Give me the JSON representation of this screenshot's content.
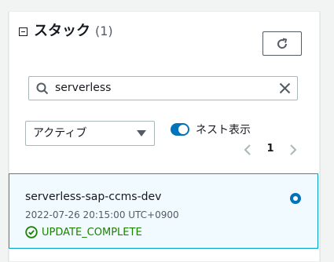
{
  "header": {
    "title": "スタック",
    "count": "(1)"
  },
  "search": {
    "value": "serverless"
  },
  "filter": {
    "selected": "アクティブ"
  },
  "nested_toggle": {
    "label": "ネスト表示",
    "on": true
  },
  "pagination": {
    "current_page": "1"
  },
  "stacks": [
    {
      "name": "serverless-sap-ccms-dev",
      "created": "2022-07-26 20:15:00 UTC+0900",
      "status": "UPDATE_COMPLETE",
      "selected": true
    }
  ],
  "colors": {
    "accent": "#0073bb",
    "selected_border": "#00a1c9",
    "selected_bg": "#f1faff",
    "success": "#1d8102"
  },
  "icons": {
    "collapse": "collapse-icon",
    "refresh": "refresh-icon",
    "search": "search-icon",
    "clear": "close-icon",
    "caret": "caret-down-icon",
    "prev": "chevron-left-icon",
    "next": "chevron-right-icon",
    "status": "check-circle-icon"
  }
}
